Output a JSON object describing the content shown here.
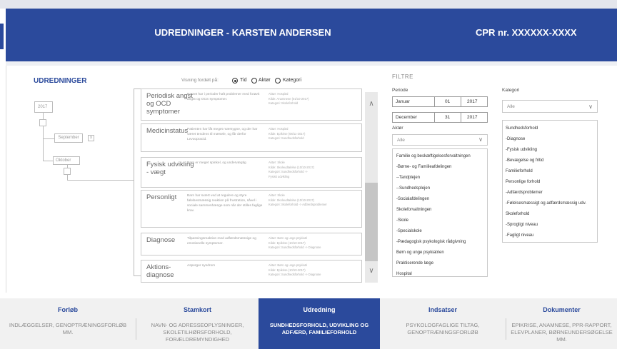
{
  "header": {
    "title": "UDREDNINGER - KARSTEN ANDERSEN",
    "cpr": "CPR nr. XXXXXX-XXXX"
  },
  "udredninger": {
    "title": "UDREDNINGER",
    "view_label": "Visning fordelt på:",
    "view_options": [
      "Tid",
      "Aktør",
      "Kategori"
    ],
    "view_selected": "Tid"
  },
  "timeline": {
    "year": "2017",
    "months": [
      "September",
      "Oktober"
    ],
    "close_symbol": "x"
  },
  "entries": [
    {
      "title": "Periodisk angst og OCD symptomer",
      "description": "Barnet har i perioder haft problemer med forøvit angst og OCS symptomer.",
      "meta": [
        "Aktør: Hospital",
        "Kilde: Anamnese (01/10-2017)",
        "Kategori: Skoleforhold"
      ]
    },
    {
      "title": "Medicinstatus",
      "description": "Patienten har fåt meget mærsygne, og der har været tendens til mæsele, og får derfor Levoopracid.",
      "meta": [
        "Aktør: Hospital",
        "Kilde: Epikrise (08/11-2017)",
        "Kategori: Sundhedsforhold"
      ]
    },
    {
      "title": "Fysisk udvikling - vægt",
      "description": "Barn er meget spinkel, og undervægtig",
      "meta": [
        "Aktør: Skole",
        "Kilde: Skoleudtalelse (10/10-2017)",
        "Kategori: Sundhedsforhold ->",
        "Fysisk udvikling"
      ]
    },
    {
      "title": "Personligt",
      "description": "Barn har svært ved at regulere og styre følelsesmæssig reaktion på frustration, såvel i sociale sammenhænge som når der stilles faglige krav.",
      "meta": [
        "Aktør: Skole",
        "Kilde: Skoleudtalelse (10/10-2017)",
        "Kategori: Skoleforhold -> Adfærdsproblemer"
      ]
    },
    {
      "title": "Diagnose",
      "description": "Tilpasningsreaktion med adfærdsmæssige og emotionelle symptomer.",
      "meta": [
        "Aktør: Børn og unge psykiatri",
        "Kilde: Epikrise (10/10-2017)",
        "Kategori: Sundhedsforhold -> Diagnose"
      ]
    },
    {
      "title": "Aktions-diagnose",
      "description": "Asperger syndrom",
      "meta": [
        "Aktør: Børn og unge psykiatri",
        "Kilde: Epikrise (10/10-2017)",
        "Kategori: Sundhedsforhold -> Diagnose"
      ]
    }
  ],
  "scroll": {
    "up": "∧",
    "down": "∨"
  },
  "filters": {
    "title": "FILTRE",
    "period_label": "Periode",
    "from": {
      "month": "Januar",
      "day": "01",
      "year": "2017"
    },
    "to": {
      "month": "December",
      "day": "31",
      "year": "2017"
    },
    "actor_label": "Aktør",
    "actor_selected": "Alle",
    "actor_items": [
      "Familie og beskæftigelsesforvaltningen",
      "-Børne- og Familieafdelingen",
      "--Tandplejen",
      "--Sundhedsplejen",
      "-Socialafdelingen",
      "Skoleforvaltningen",
      "-Skole",
      "-Specialskole",
      "-Pædagogisk psykologisk rådgivning",
      "Børn og unge psykiatrien",
      "Praktiserende læge",
      "Hospital"
    ],
    "category_label": "Kategori",
    "category_selected": "Alle",
    "category_items": [
      "Sundhedsforhold",
      "-Diagnose",
      "-Fysisk udvikling",
      "-Bevægelse og fritid",
      "Familieforhold",
      "Personlige forhold",
      "-Adfærdsproblemer",
      "-Følelsesmæssigt og adfærdsmæssig udv.",
      "Skoleforhold",
      "-Sprogligt niveau",
      "-Fagligt niveau"
    ]
  },
  "nav": [
    {
      "heading": "Forløb",
      "body": "INDLÆGGELSER, GENOPTRÆNINGSFORLØB MM."
    },
    {
      "heading": "Stamkort",
      "body": "NAVN- OG ADRESSEOPLYSNINGER, SKOLETILHØRSFORHOLD, FORÆLDREMYNDIGHED"
    },
    {
      "heading": "Udredning",
      "body": "SUNDHEDSFORHOLD, UDVIKLING OG ADFÆRD, FAMILIEFORHOLD",
      "active": true
    },
    {
      "heading": "Indsatser",
      "body": "PSYKOLOGFAGLIGE TILTAG, GENOPTRÆNINGSFORLØB"
    },
    {
      "heading": "Dokumenter",
      "body": "EPIKRISE, ANAMNESE, PPR-RAPPORT, ELEVPLANER, BØRNEUNDERSØGELSE MM."
    }
  ],
  "colors": {
    "primary": "#2b4a9c",
    "nav_background": "#f1f1f1"
  }
}
